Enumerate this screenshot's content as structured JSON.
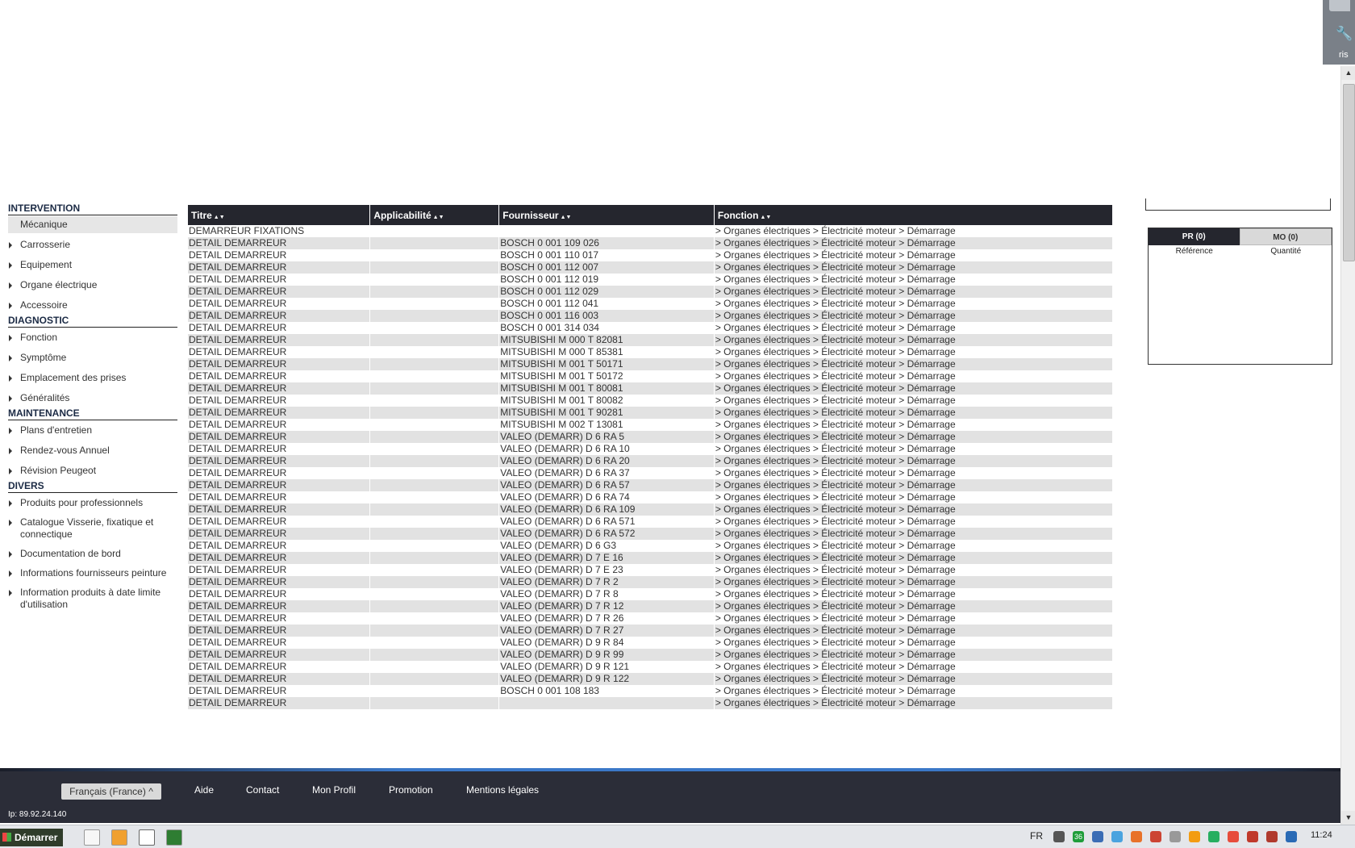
{
  "top_right_overlay": {
    "text": "ris"
  },
  "sidebar": {
    "sections": [
      {
        "title": "INTERVENTION",
        "items": [
          {
            "label": "Mécanique",
            "active": true
          },
          {
            "label": "Carrosserie"
          },
          {
            "label": "Equipement"
          },
          {
            "label": "Organe électrique"
          },
          {
            "label": "Accessoire"
          }
        ]
      },
      {
        "title": "DIAGNOSTIC",
        "items": [
          {
            "label": "Fonction"
          },
          {
            "label": "Symptôme"
          },
          {
            "label": "Emplacement des prises"
          },
          {
            "label": "Généralités"
          }
        ]
      },
      {
        "title": "MAINTENANCE",
        "items": [
          {
            "label": "Plans d'entretien"
          },
          {
            "label": "Rendez-vous Annuel"
          },
          {
            "label": "Révision Peugeot"
          }
        ]
      },
      {
        "title": "DIVERS",
        "items": [
          {
            "label": "Produits pour professionnels"
          },
          {
            "label": "Catalogue Visserie, fixatique et connectique"
          },
          {
            "label": "Documentation de bord"
          },
          {
            "label": "Informations fournisseurs peinture"
          },
          {
            "label": "Information produits à date limite d'utilisation"
          }
        ]
      }
    ]
  },
  "table": {
    "headers": [
      "Titre",
      "Applicabilité",
      "Fournisseur",
      "Fonction"
    ],
    "sort_glyph": "▲▼",
    "rows": [
      [
        "DEMARREUR FIXATIONS",
        "",
        "",
        "> Organes électriques > Électricité moteur > Démarrage"
      ],
      [
        "DETAIL DEMARREUR",
        "",
        "BOSCH 0 001 109 026",
        "> Organes électriques > Électricité moteur > Démarrage"
      ],
      [
        "DETAIL DEMARREUR",
        "",
        "BOSCH 0 001 110 017",
        "> Organes électriques > Électricité moteur > Démarrage"
      ],
      [
        "DETAIL DEMARREUR",
        "",
        "BOSCH 0 001 112 007",
        "> Organes électriques > Électricité moteur > Démarrage"
      ],
      [
        "DETAIL DEMARREUR",
        "",
        "BOSCH 0 001 112 019",
        "> Organes électriques > Électricité moteur > Démarrage"
      ],
      [
        "DETAIL DEMARREUR",
        "",
        "BOSCH 0 001 112 029",
        "> Organes électriques > Électricité moteur > Démarrage"
      ],
      [
        "DETAIL DEMARREUR",
        "",
        "BOSCH 0 001 112 041",
        "> Organes électriques > Électricité moteur > Démarrage"
      ],
      [
        "DETAIL DEMARREUR",
        "",
        "BOSCH 0 001 116 003",
        "> Organes électriques > Électricité moteur > Démarrage"
      ],
      [
        "DETAIL DEMARREUR",
        "",
        "BOSCH 0 001 314 034",
        "> Organes électriques > Électricité moteur > Démarrage"
      ],
      [
        "DETAIL DEMARREUR",
        "",
        "MITSUBISHI M 000 T 82081",
        "> Organes électriques > Électricité moteur > Démarrage"
      ],
      [
        "DETAIL DEMARREUR",
        "",
        "MITSUBISHI M 000 T 85381",
        "> Organes électriques > Électricité moteur > Démarrage"
      ],
      [
        "DETAIL DEMARREUR",
        "",
        "MITSUBISHI M 001 T 50171",
        "> Organes électriques > Électricité moteur > Démarrage"
      ],
      [
        "DETAIL DEMARREUR",
        "",
        "MITSUBISHI M 001 T 50172",
        "> Organes électriques > Électricité moteur > Démarrage"
      ],
      [
        "DETAIL DEMARREUR",
        "",
        "MITSUBISHI M 001 T 80081",
        "> Organes électriques > Électricité moteur > Démarrage"
      ],
      [
        "DETAIL DEMARREUR",
        "",
        "MITSUBISHI M 001 T 80082",
        "> Organes électriques > Électricité moteur > Démarrage"
      ],
      [
        "DETAIL DEMARREUR",
        "",
        "MITSUBISHI M 001 T 90281",
        "> Organes électriques > Électricité moteur > Démarrage"
      ],
      [
        "DETAIL DEMARREUR",
        "",
        "MITSUBISHI M 002 T 13081",
        "> Organes électriques > Électricité moteur > Démarrage"
      ],
      [
        "DETAIL DEMARREUR",
        "",
        "VALEO (DEMARR) D 6 RA 5",
        "> Organes électriques > Électricité moteur > Démarrage"
      ],
      [
        "DETAIL DEMARREUR",
        "",
        "VALEO (DEMARR) D 6 RA 10",
        "> Organes électriques > Électricité moteur > Démarrage"
      ],
      [
        "DETAIL DEMARREUR",
        "",
        "VALEO (DEMARR) D 6 RA 20",
        "> Organes électriques > Électricité moteur > Démarrage"
      ],
      [
        "DETAIL DEMARREUR",
        "",
        "VALEO (DEMARR) D 6 RA 37",
        "> Organes électriques > Électricité moteur > Démarrage"
      ],
      [
        "DETAIL DEMARREUR",
        "",
        "VALEO (DEMARR) D 6 RA 57",
        "> Organes électriques > Électricité moteur > Démarrage"
      ],
      [
        "DETAIL DEMARREUR",
        "",
        "VALEO (DEMARR) D 6 RA 74",
        "> Organes électriques > Électricité moteur > Démarrage"
      ],
      [
        "DETAIL DEMARREUR",
        "",
        "VALEO (DEMARR) D 6 RA 109",
        "> Organes électriques > Électricité moteur > Démarrage"
      ],
      [
        "DETAIL DEMARREUR",
        "",
        "VALEO (DEMARR) D 6 RA 571",
        "> Organes électriques > Électricité moteur > Démarrage"
      ],
      [
        "DETAIL DEMARREUR",
        "",
        "VALEO (DEMARR) D 6 RA 572",
        "> Organes électriques > Électricité moteur > Démarrage"
      ],
      [
        "DETAIL DEMARREUR",
        "",
        "VALEO (DEMARR) D 6 G3",
        "> Organes électriques > Électricité moteur > Démarrage"
      ],
      [
        "DETAIL DEMARREUR",
        "",
        "VALEO (DEMARR) D 7 E 16",
        "> Organes électriques > Électricité moteur > Démarrage"
      ],
      [
        "DETAIL DEMARREUR",
        "",
        "VALEO (DEMARR) D 7 E 23",
        "> Organes électriques > Électricité moteur > Démarrage"
      ],
      [
        "DETAIL DEMARREUR",
        "",
        "VALEO (DEMARR) D 7 R 2",
        "> Organes électriques > Électricité moteur > Démarrage"
      ],
      [
        "DETAIL DEMARREUR",
        "",
        "VALEO (DEMARR) D 7 R 8",
        "> Organes électriques > Électricité moteur > Démarrage"
      ],
      [
        "DETAIL DEMARREUR",
        "",
        "VALEO (DEMARR) D 7 R 12",
        "> Organes électriques > Électricité moteur > Démarrage"
      ],
      [
        "DETAIL DEMARREUR",
        "",
        "VALEO (DEMARR) D 7 R 26",
        "> Organes électriques > Électricité moteur > Démarrage"
      ],
      [
        "DETAIL DEMARREUR",
        "",
        "VALEO (DEMARR) D 7 R 27",
        "> Organes électriques > Électricité moteur > Démarrage"
      ],
      [
        "DETAIL DEMARREUR",
        "",
        "VALEO (DEMARR) D 9 R 84",
        "> Organes électriques > Électricité moteur > Démarrage"
      ],
      [
        "DETAIL DEMARREUR",
        "",
        "VALEO (DEMARR) D 9 R 99",
        "> Organes électriques > Électricité moteur > Démarrage"
      ],
      [
        "DETAIL DEMARREUR",
        "",
        "VALEO (DEMARR) D 9 R 121",
        "> Organes électriques > Électricité moteur > Démarrage"
      ],
      [
        "DETAIL DEMARREUR",
        "",
        "VALEO (DEMARR) D 9 R 122",
        "> Organes électriques > Électricité moteur > Démarrage"
      ],
      [
        "DETAIL DEMARREUR",
        "",
        "BOSCH 0 001 108 183",
        "> Organes électriques > Électricité moteur > Démarrage"
      ],
      [
        "DETAIL DEMARREUR",
        "",
        "",
        "> Organes électriques > Électricité moteur > Démarrage"
      ]
    ]
  },
  "panel": {
    "tab_pr": "PR (0)",
    "tab_mo": "MO (0)",
    "col_reference": "Référence",
    "col_quantite": "Quantité"
  },
  "footer": {
    "language": "Français (France)",
    "links": [
      "Aide",
      "Contact",
      "Mon Profil",
      "Promotion",
      "Mentions légales"
    ],
    "ip": "Ip: 89.92.24.140"
  },
  "taskbar": {
    "start_label": "Démarrer",
    "tray_lang": "FR",
    "clock": "11:24",
    "tray_badge": "36"
  },
  "colors": {
    "header_bg": "#25262e",
    "row_alt": "#e2e2e2",
    "footer_bg": "#2b2d38",
    "accent_line": "#3b78c8"
  }
}
